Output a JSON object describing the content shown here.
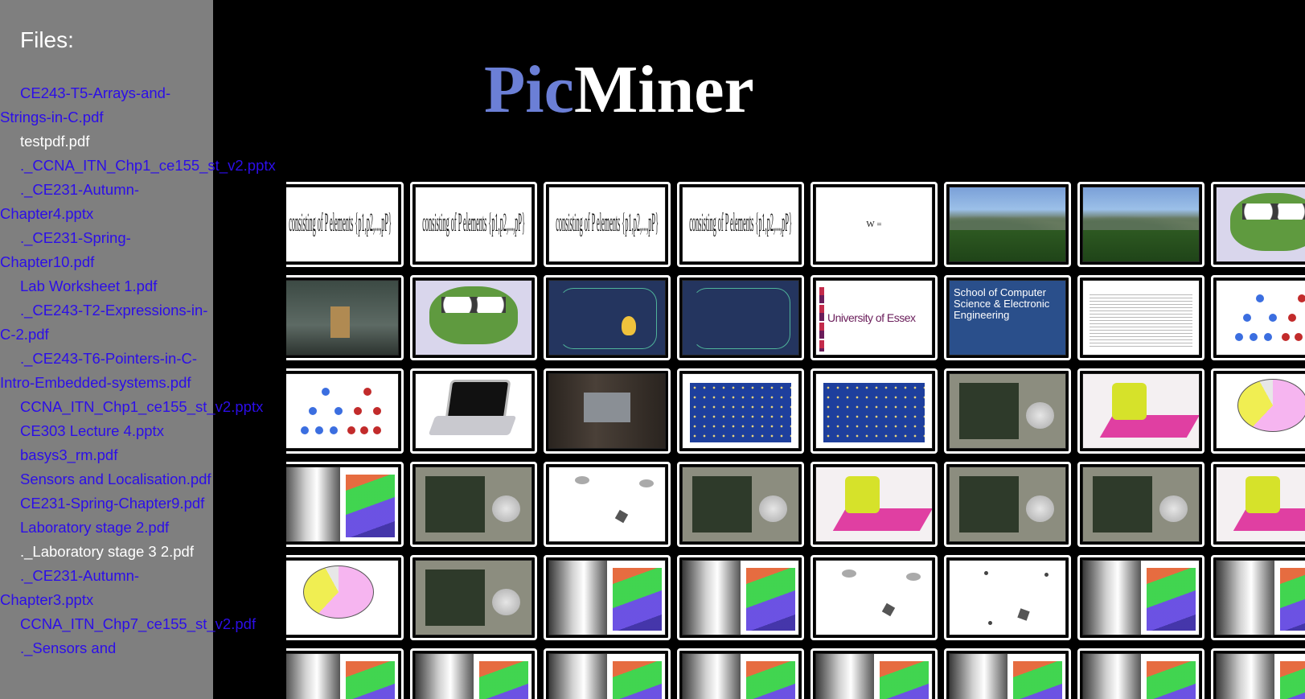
{
  "sidebar": {
    "title": "Files:",
    "files": [
      {
        "label": "CE243-T5-Arrays-and-Strings-in-C.pdf",
        "visited": false,
        "nowrap": false
      },
      {
        "label": "testpdf.pdf",
        "visited": true,
        "nowrap": true
      },
      {
        "label": "._CCNA_ITN_Chp1_ce155_st_v2.pptx",
        "visited": false,
        "nowrap": true
      },
      {
        "label": "._CE231-Autumn-Chapter4.pptx",
        "visited": false,
        "nowrap": false
      },
      {
        "label": "._CE231-Spring-Chapter10.pdf",
        "visited": false,
        "nowrap": false
      },
      {
        "label": "Lab Worksheet 1.pdf",
        "visited": false,
        "nowrap": true
      },
      {
        "label": "._CE243-T2-Expressions-in-C-2.pdf",
        "visited": false,
        "nowrap": false
      },
      {
        "label": "._CE243-T6-Pointers-in-C-Intro-Embedded-systems.pdf",
        "visited": false,
        "nowrap": false
      },
      {
        "label": "CCNA_ITN_Chp1_ce155_st_v2.pptx",
        "visited": false,
        "nowrap": true
      },
      {
        "label": "CE303 Lecture 4.pptx",
        "visited": false,
        "nowrap": true
      },
      {
        "label": "basys3_rm.pdf",
        "visited": false,
        "nowrap": true
      },
      {
        "label": "Sensors and Localisation.pdf",
        "visited": false,
        "nowrap": false
      },
      {
        "label": "CE231-Spring-Chapter9.pdf",
        "visited": false,
        "nowrap": false
      },
      {
        "label": "Laboratory stage 2.pdf",
        "visited": false,
        "nowrap": true
      },
      {
        "label": "._Laboratory stage 3 2.pdf",
        "visited": true,
        "nowrap": true
      },
      {
        "label": "._CE231-Autumn-Chapter3.pptx",
        "visited": false,
        "nowrap": false
      },
      {
        "label": "CCNA_ITN_Chp7_ce155_st_v2.pdf",
        "visited": false,
        "nowrap": true
      },
      {
        "label": "._Sensors and",
        "visited": false,
        "nowrap": true
      }
    ]
  },
  "logo": {
    "part1": "Pic",
    "part2": "Miner"
  },
  "grid": {
    "rows": [
      [
        "formula",
        "formula",
        "formula",
        "formula",
        "matrix",
        "forest",
        "forest",
        "frog"
      ],
      [
        "box",
        "frog",
        "navy-bulb",
        "navy",
        "essex",
        "school",
        "doc",
        "tree"
      ],
      [
        "tree",
        "laptop",
        "rack",
        "board",
        "board",
        "camera",
        "robot",
        "pie"
      ],
      [
        "depth",
        "camera",
        "dots",
        "camera",
        "robot",
        "camera",
        "camera",
        "robot"
      ],
      [
        "pie",
        "camera",
        "depth",
        "depth",
        "dots",
        "dots2",
        "depth",
        "depth"
      ],
      [
        "depth",
        "depth",
        "depth",
        "depth",
        "depth",
        "depth",
        "depth",
        "depth"
      ]
    ],
    "formula_text": "consisting of P elements {p1,p2,...,pP}",
    "matrix_text": "W =",
    "essex_text": "University of Essex",
    "school_text": "School of Computer Science & Electronic Engineering"
  }
}
